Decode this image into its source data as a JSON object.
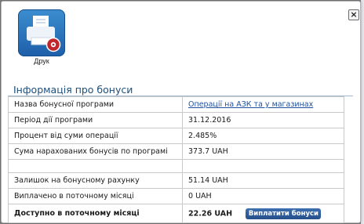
{
  "dialog": {
    "close_symbol": "×",
    "print_label": "Друк",
    "print_icon": "printer-settings-icon"
  },
  "section": {
    "title": "Інформація про бонуси"
  },
  "rows": {
    "program_name": {
      "label": "Назва бонусної програми",
      "value": "Операції на АЗК та у магазинах"
    },
    "period": {
      "label": "Період дії програми",
      "value": "31.12.2016"
    },
    "percent": {
      "label": "Процент від суми операції",
      "value": "2.485%"
    },
    "accrued": {
      "label": "Сума нарахованих бонусів по програмі",
      "value": "373.7 UAH"
    },
    "balance": {
      "label": "Залишок на бонусному рахунку",
      "value": "51.14 UAH"
    },
    "paid": {
      "label": "Виплачено в поточному місяці",
      "value": "0 UAH"
    },
    "available": {
      "label": "Доступно в поточному місяці",
      "value": "22.26 UAH"
    }
  },
  "actions": {
    "pay_label": "Виплатити бонуси"
  },
  "colors": {
    "accent": "#1d4f7c",
    "button": "#2d5a96",
    "link": "#1f4f9a"
  }
}
